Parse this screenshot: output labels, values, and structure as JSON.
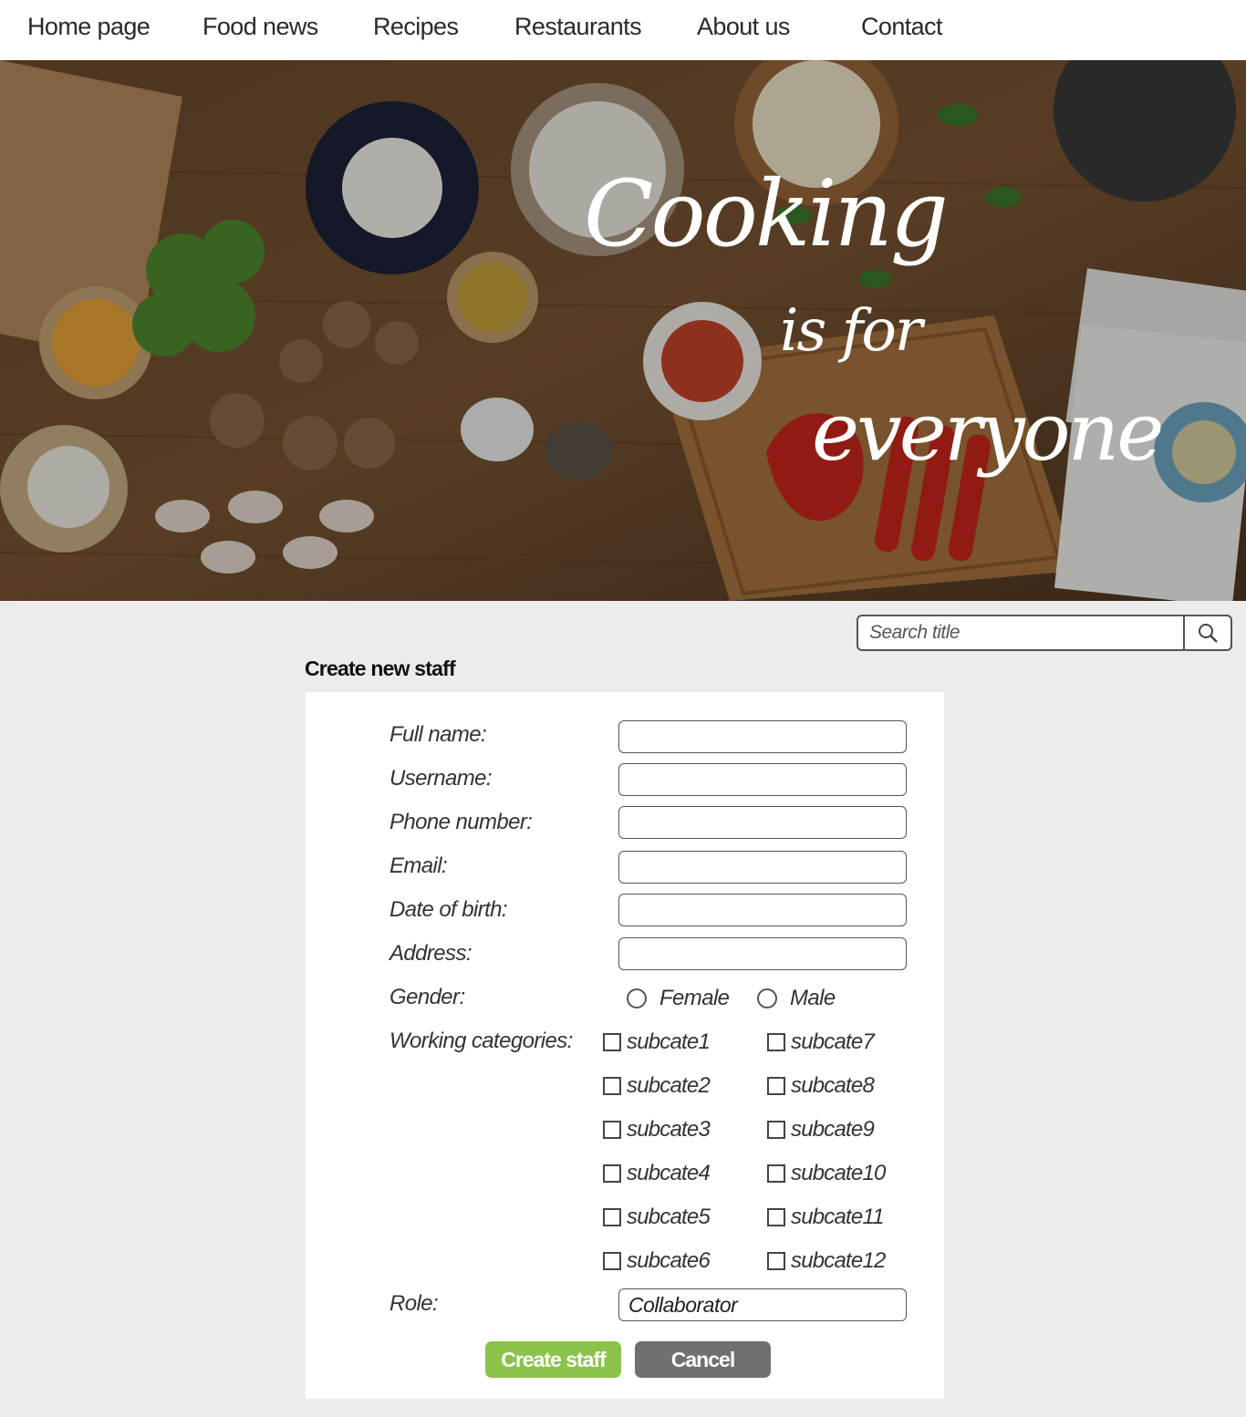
{
  "nav": {
    "items": [
      {
        "label": "Home page"
      },
      {
        "label": "Food news"
      },
      {
        "label": "Recipes"
      },
      {
        "label": "Restaurants"
      },
      {
        "label": "About us"
      },
      {
        "label": "Contact"
      }
    ]
  },
  "hero": {
    "line1": "Cooking",
    "line2": "is for",
    "line3": "everyone"
  },
  "search": {
    "placeholder": "Search title",
    "icon": "search-icon"
  },
  "form": {
    "title": "Create new staff",
    "fields": {
      "full_name": {
        "label": "Full name:",
        "value": ""
      },
      "username": {
        "label": "Username:",
        "value": ""
      },
      "phone": {
        "label": "Phone number:",
        "value": ""
      },
      "email": {
        "label": "Email:",
        "value": ""
      },
      "dob": {
        "label": "Date of birth:",
        "value": ""
      },
      "address": {
        "label": "Address:",
        "value": ""
      }
    },
    "gender": {
      "label": "Gender:",
      "options": [
        "Female",
        "Male"
      ]
    },
    "categories": {
      "label": "Working categories:",
      "items": [
        "subcate1",
        "subcate2",
        "subcate3",
        "subcate4",
        "subcate5",
        "subcate6",
        "subcate7",
        "subcate8",
        "subcate9",
        "subcate10",
        "subcate11",
        "subcate12"
      ]
    },
    "role": {
      "label": "Role:",
      "value": "Collaborator"
    },
    "buttons": {
      "create": "Create staff",
      "cancel": "Cancel"
    },
    "colors": {
      "create": "#8bc34a",
      "cancel": "#707070"
    }
  }
}
